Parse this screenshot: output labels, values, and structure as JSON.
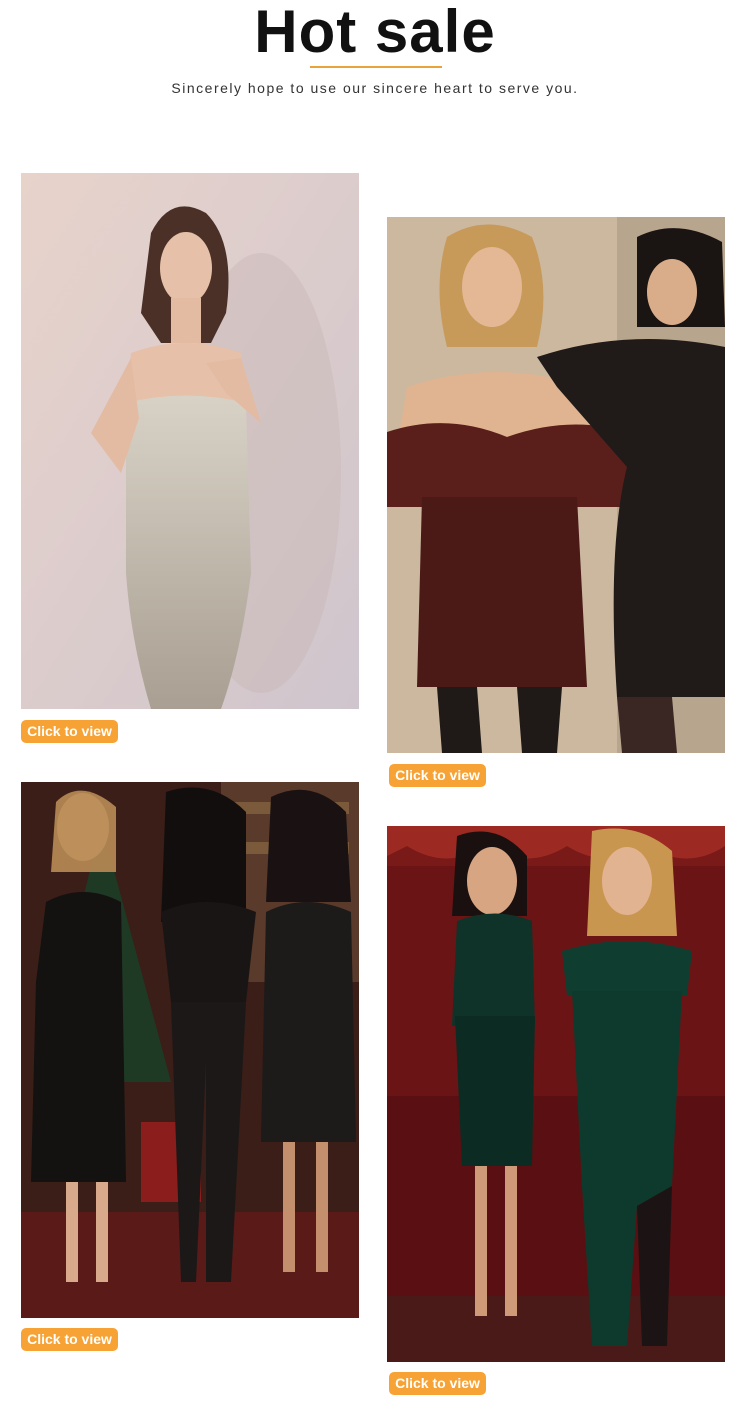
{
  "header": {
    "title": "Hot sale",
    "subtitle": "Sincerely hope to use our sincere heart to serve you.",
    "accent_color": "#e8a33a"
  },
  "products": [
    {
      "button_label": "Click to view"
    },
    {
      "button_label": "Click to view"
    },
    {
      "button_label": "Click to view"
    },
    {
      "button_label": "Click to view"
    }
  ],
  "colors": {
    "button": "#f7a234",
    "button_text": "#ffffff"
  }
}
